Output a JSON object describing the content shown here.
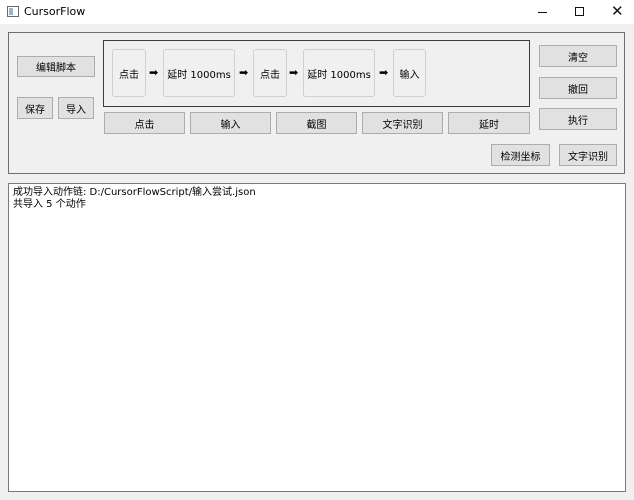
{
  "window": {
    "title": "CursorFlow"
  },
  "left_panel": {
    "edit_label": "编辑脚本",
    "save_label": "保存",
    "import_label": "导入"
  },
  "flow": {
    "arrow": "➡",
    "steps": [
      {
        "label": "点击"
      },
      {
        "label": "延时 1000ms"
      },
      {
        "label": "点击"
      },
      {
        "label": "延时 1000ms"
      },
      {
        "label": "输入"
      }
    ]
  },
  "add_actions": [
    "点击",
    "输入",
    "截图",
    "文字识别",
    "延时"
  ],
  "right_panel": {
    "clear_label": "清空",
    "undo_label": "撤回",
    "execute_label": "执行",
    "detect_coords_label": "检测坐标",
    "ocr_label": "文字识别"
  },
  "log": {
    "lines": [
      "成功导入动作链: D:/CursorFlowScript/输入尝试.json",
      "共导入 5 个动作"
    ]
  }
}
